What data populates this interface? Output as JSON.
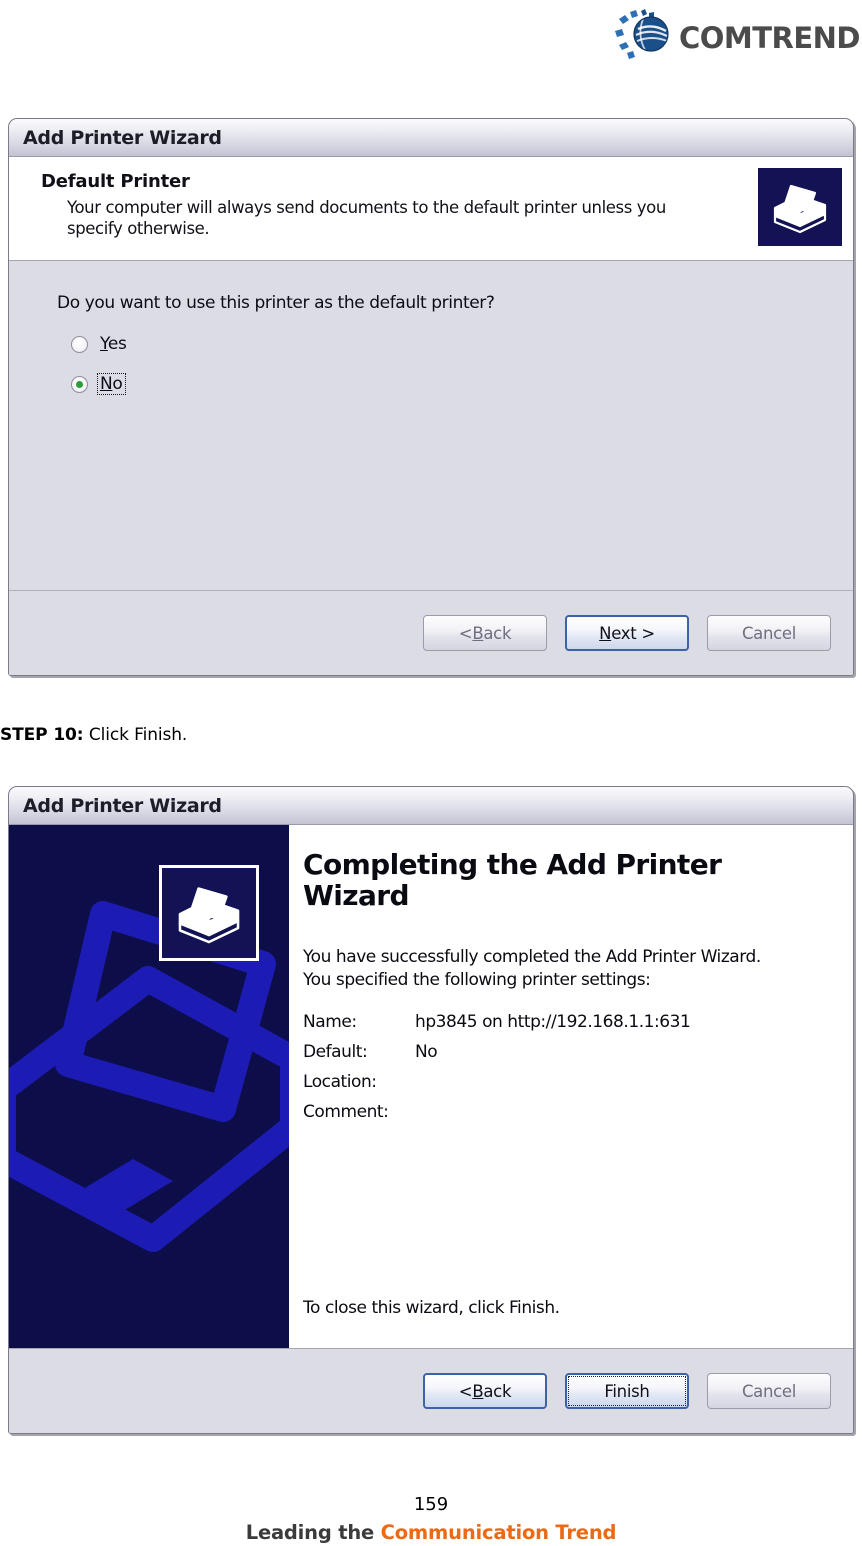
{
  "brand": {
    "name": "COMTREND",
    "logo_icon": "comtrend-globe-logo",
    "globe_color": "#1a4f8a",
    "ray_color": "#2f6fb5",
    "wordmark_color": "#4b4b4b"
  },
  "dialog1": {
    "window_title": "Add Printer Wizard",
    "header": {
      "title": "Default Printer",
      "subtitle": "Your computer will always send documents to the default printer unless you specify otherwise.",
      "icon": "printer-icon"
    },
    "question": "Do you want to use this printer as the default printer?",
    "options": [
      {
        "label": "Yes",
        "accelerator": "Y",
        "selected": false,
        "focused": false
      },
      {
        "label": "No",
        "accelerator": "N",
        "selected": true,
        "focused": true
      }
    ],
    "buttons": [
      {
        "label": "< Back",
        "accelerator": "B",
        "state": "disabled",
        "default": false,
        "focus_ring": false
      },
      {
        "label": "Next >",
        "accelerator": "N",
        "state": "enabled",
        "default": true,
        "focus_ring": false
      },
      {
        "label": "Cancel",
        "accelerator": "",
        "state": "disabled",
        "default": false,
        "focus_ring": false
      }
    ]
  },
  "step": {
    "label": "STEP 10:",
    "text": "Click Finish."
  },
  "dialog2": {
    "window_title": "Add Printer Wizard",
    "banner": {
      "background_color": "#0d0d4a",
      "watermark_icon": "printer-watermark-icon",
      "icon": "printer-icon"
    },
    "title": "Completing the Add Printer Wizard",
    "paragraph_line1": "You have successfully completed the Add Printer Wizard.",
    "paragraph_line2": "You specified the following printer settings:",
    "settings": [
      {
        "label": "Name:",
        "value": "hp3845 on http://192.168.1.1:631"
      },
      {
        "label": "Default:",
        "value": "No"
      },
      {
        "label": "Location:",
        "value": ""
      },
      {
        "label": "Comment:",
        "value": ""
      }
    ],
    "closing_text": "To close this wizard, click Finish.",
    "buttons": [
      {
        "label": "< Back",
        "accelerator": "B",
        "state": "enabled",
        "default": true,
        "focus_ring": false
      },
      {
        "label": "Finish",
        "accelerator": "",
        "state": "enabled",
        "default": true,
        "focus_ring": true
      },
      {
        "label": "Cancel",
        "accelerator": "",
        "state": "disabled",
        "default": false,
        "focus_ring": false
      }
    ]
  },
  "footer": {
    "page_number": "159",
    "tagline_part1": "Leading the ",
    "tagline_part2": "Communication ",
    "tagline_part3": "Trend",
    "tagline_accent_color": "#ec6a15"
  }
}
